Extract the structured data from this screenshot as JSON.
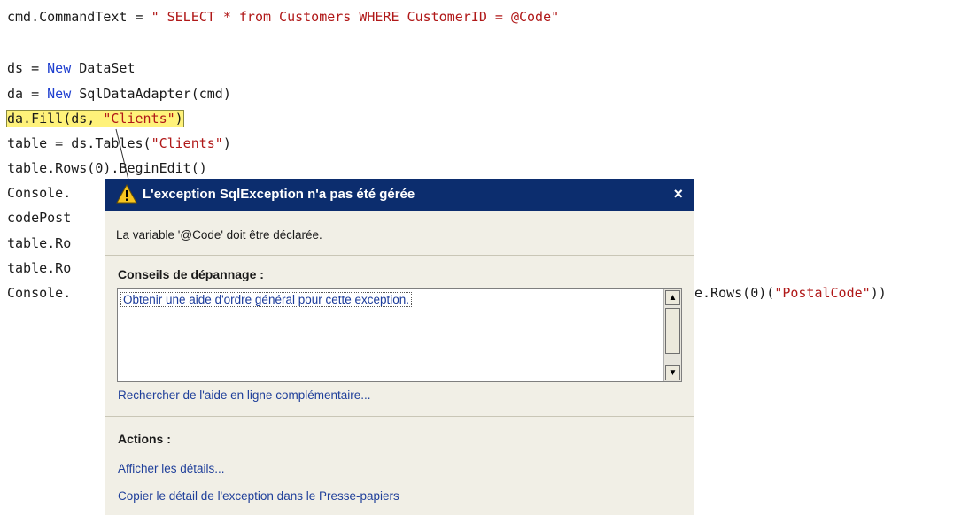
{
  "code": {
    "line1": {
      "a": "cmd.CommandText = ",
      "b": "\" SELECT * from Customers WHERE CustomerID = @Code\""
    },
    "line2": {
      "a": "ds = ",
      "kw": "New",
      "b": " DataSet"
    },
    "line3": {
      "a": "da = ",
      "kw": "New",
      "b": " SqlDataAdapter(cmd)"
    },
    "line4": {
      "a": "da.Fill(ds, ",
      "str": "\"Clients\"",
      "b": ")"
    },
    "line5": {
      "a": "table = ds.Tables(",
      "str": "\"Clients\"",
      "b": ")"
    },
    "line6": {
      "a": "table.Rows(0).BeginEdit()"
    },
    "line7": {
      "a": "Console."
    },
    "line8": {
      "a": "codePost"
    },
    "line9": {
      "a": "table.Ro"
    },
    "line10": {
      "a": "table.Ro"
    },
    "line11": {
      "a": "Console."
    },
    "line11_tail": {
      "a": "e.Rows(0)(",
      "str": "\"PostalCode\"",
      "b": "))"
    }
  },
  "dialog": {
    "title": "L'exception SqlException n'a pas été gérée",
    "close_glyph": "×",
    "message": "La variable '@Code' doit être déclarée.",
    "tips_heading": "Conseils de dépannage :",
    "tips": [
      "Obtenir une aide d'ordre général pour cette exception."
    ],
    "online_help_link": "Rechercher de l'aide en ligne complémentaire...",
    "actions_heading": "Actions :",
    "actions": [
      "Afficher les détails...",
      "Copier le détail de l'exception dans le Presse-papiers"
    ]
  },
  "colors": {
    "titlebar": "#0c2d6e",
    "highlight": "#fff27a",
    "keyword": "#1f3fcf",
    "string": "#b01818"
  },
  "icons": {
    "warning": "warning-icon",
    "close": "close-icon",
    "scroll_up": "scroll-up-icon",
    "scroll_down": "scroll-down-icon"
  }
}
